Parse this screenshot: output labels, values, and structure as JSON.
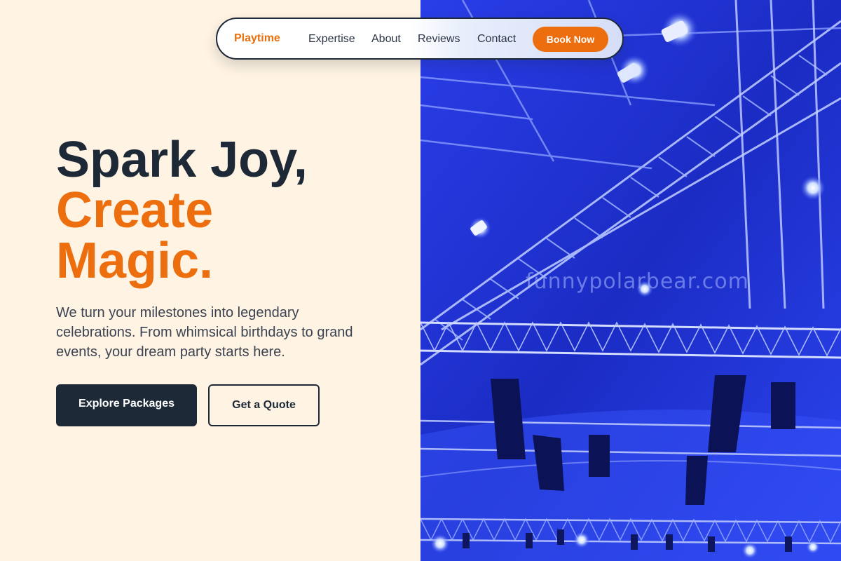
{
  "nav": {
    "brand": "Playtime",
    "links": [
      "Expertise",
      "About",
      "Reviews",
      "Contact"
    ],
    "cta_label": "Book Now"
  },
  "hero": {
    "headline_line1": "Spark Joy,",
    "headline_line2": "Create",
    "headline_line3": "Magic.",
    "description": "We turn your milestones into legendary celebrations. From whimsical birthdays to grand events, your dream party starts here.",
    "primary_button": "Explore Packages",
    "secondary_button": "Get a Quote"
  },
  "image": {
    "subject": "stage-truss-lighting-photo",
    "watermark": "funnypolarbear.com"
  },
  "colors": {
    "accent": "#ec6e0f",
    "dark": "#1e2937",
    "background": "#fff3e3",
    "photo_blue": "#2539ea"
  }
}
